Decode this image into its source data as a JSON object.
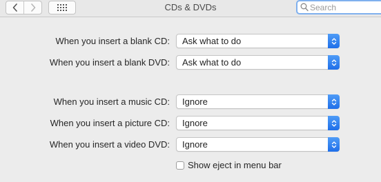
{
  "window": {
    "title": "CDs & DVDs"
  },
  "toolbar": {
    "back_icon": "chevron-left-icon",
    "forward_icon": "chevron-right-icon",
    "grid_icon": "grid-icon",
    "search_placeholder": "Search"
  },
  "settings": {
    "blank_cd": {
      "label": "When you insert a blank CD:",
      "value": "Ask what to do"
    },
    "blank_dvd": {
      "label": "When you insert a blank DVD:",
      "value": "Ask what to do"
    },
    "music_cd": {
      "label": "When you insert a music CD:",
      "value": "Ignore"
    },
    "picture_cd": {
      "label": "When you insert a picture CD:",
      "value": "Ignore"
    },
    "video_dvd": {
      "label": "When you insert a video DVD:",
      "value": "Ignore"
    }
  },
  "eject": {
    "label": "Show eject in menu bar",
    "checked": false
  },
  "colors": {
    "accent": "#1f6fe9",
    "search_focus": "#7fb0ee"
  }
}
